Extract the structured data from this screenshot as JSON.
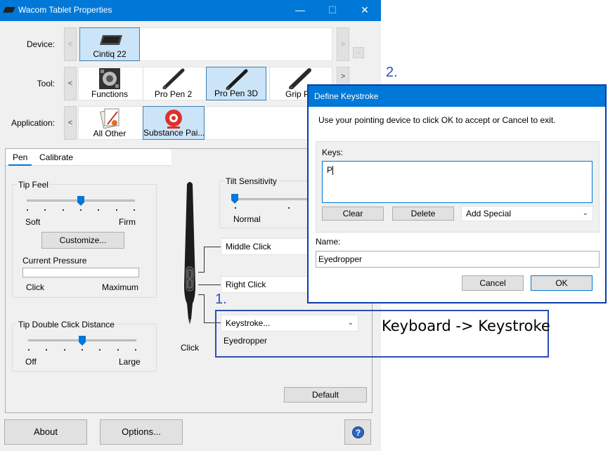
{
  "window": {
    "title": "Wacom Tablet Properties",
    "controls": {
      "minimize": "—",
      "maximize": "☐",
      "close": "✕"
    }
  },
  "device": {
    "label": "Device:",
    "items": [
      {
        "label": "Cintiq 22",
        "icon": "tablet-icon"
      }
    ],
    "nav_left": "<",
    "nav_right": ">",
    "remove": "-"
  },
  "tool": {
    "label": "Tool:",
    "nav_left": "<",
    "nav_right": ">",
    "items": [
      {
        "label": "Functions",
        "icon": "functions-icon"
      },
      {
        "label": "Pro Pen 2",
        "icon": "pen-icon"
      },
      {
        "label": "Pro Pen 3D",
        "icon": "pen-3d-icon"
      },
      {
        "label": "Grip Pe",
        "icon": "grip-pen-icon"
      }
    ]
  },
  "application": {
    "label": "Application:",
    "nav_left": "<",
    "items": [
      {
        "label": "All Other",
        "icon": "all-other-icon"
      },
      {
        "label": "Substance Pai...",
        "icon": "substance-painter-icon"
      }
    ]
  },
  "tabs": [
    "Pen",
    "Calibrate"
  ],
  "tip_feel": {
    "title": "Tip Feel",
    "min_label": "Soft",
    "max_label": "Firm",
    "level": 0.5,
    "customize": "Customize...",
    "pressure_label": "Current Pressure",
    "pressure_min": "Click",
    "pressure_max": "Maximum"
  },
  "tip_double_click": {
    "title": "Tip Double Click Distance",
    "min_label": "Off",
    "max_label": "Large",
    "level": 0.5
  },
  "tilt": {
    "title": "Tilt Sensitivity",
    "min_label": "Normal",
    "level": 0.0
  },
  "pen_buttons": {
    "upper": "Middle Click",
    "lower": "Right Click",
    "tip_dropdown": "Keystroke...",
    "tip_name": "Eyedropper",
    "tip_label": "Click"
  },
  "default_button": "Default",
  "footer": {
    "about": "About",
    "options": "Options...",
    "help": "?"
  },
  "dialog": {
    "title": "Define Keystroke",
    "instruction": "Use your pointing device to click OK to accept or Cancel to exit.",
    "keys_label": "Keys:",
    "keys_value": "P",
    "clear": "Clear",
    "delete": "Delete",
    "add_special": "Add Special",
    "name_label": "Name:",
    "name_value": "Eyedropper",
    "cancel": "Cancel",
    "ok": "OK"
  },
  "annotations": {
    "step1": "1.",
    "step2": "2.",
    "caption": "Keyboard -> Keystroke",
    "color": "#2b4fb8"
  }
}
